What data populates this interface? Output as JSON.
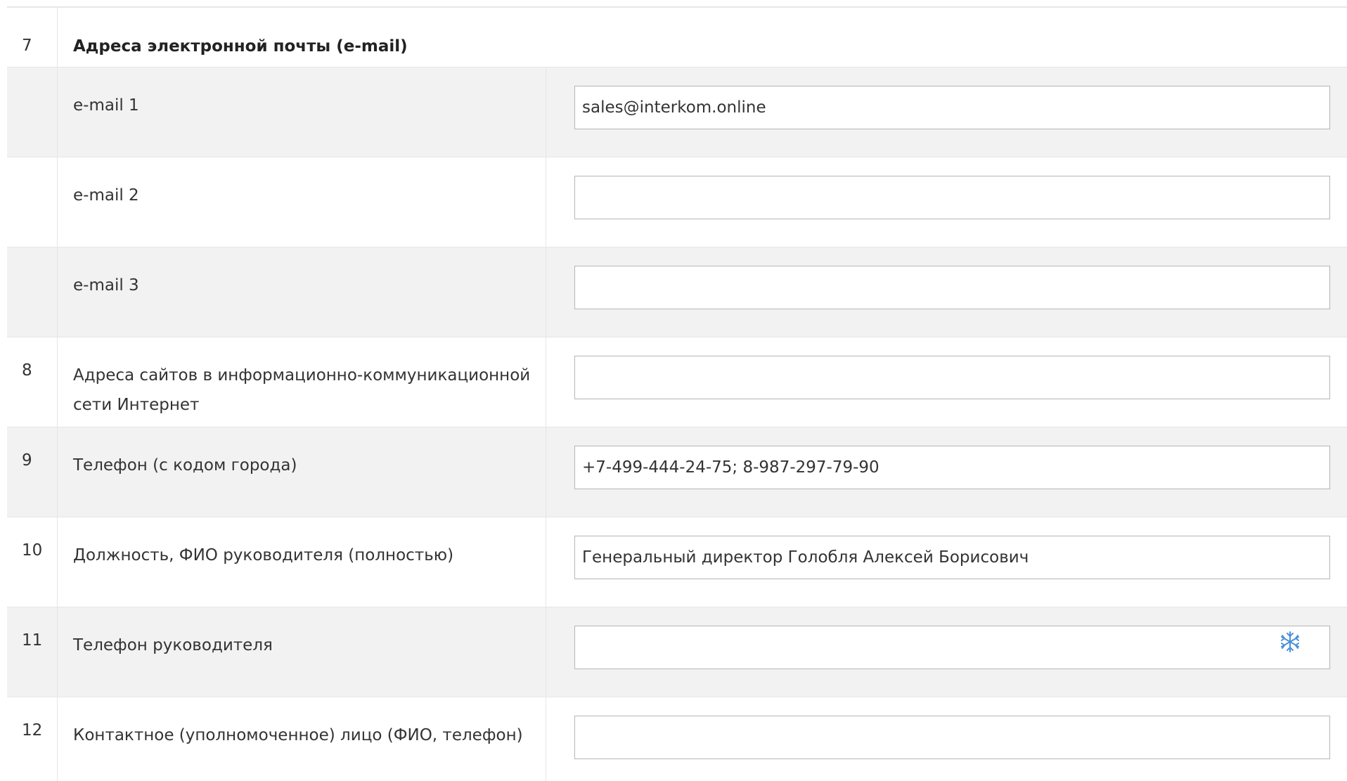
{
  "section": {
    "number": "7",
    "title": "Адреса электронной почты (e-mail)"
  },
  "rows": [
    {
      "number": "",
      "label": "e-mail 1",
      "value": "sales@interkom.online",
      "placeholder": ""
    },
    {
      "number": "",
      "label": "e-mail 2",
      "value": "",
      "placeholder": ""
    },
    {
      "number": "",
      "label": "e-mail 3",
      "value": "",
      "placeholder": ""
    },
    {
      "number": "8",
      "label": "Адреса сайтов в информационно-коммуникационной сети Интернет",
      "value": "",
      "placeholder": ""
    },
    {
      "number": "9",
      "label": "Телефон (с кодом города)",
      "value": "+7-499-444-24-75; 8-987-297-79-90",
      "placeholder": ""
    },
    {
      "number": "10",
      "label": "Должность, ФИО руководителя (полностью)",
      "value": "Генеральный директор Голобля Алексей Борисович",
      "placeholder": ""
    },
    {
      "number": "11",
      "label": "Телефон руководителя",
      "value": "",
      "placeholder": "",
      "icon": "snowflake-icon"
    },
    {
      "number": "12",
      "label": "Контактное (уполномоченное) лицо (ФИО, телефон)",
      "value": "",
      "placeholder": ""
    }
  ],
  "colors": {
    "shaded_row": "#f2f2f2",
    "border": "#e6e6e6",
    "input_border": "#b5b5b5",
    "icon": "#4a90d9"
  }
}
